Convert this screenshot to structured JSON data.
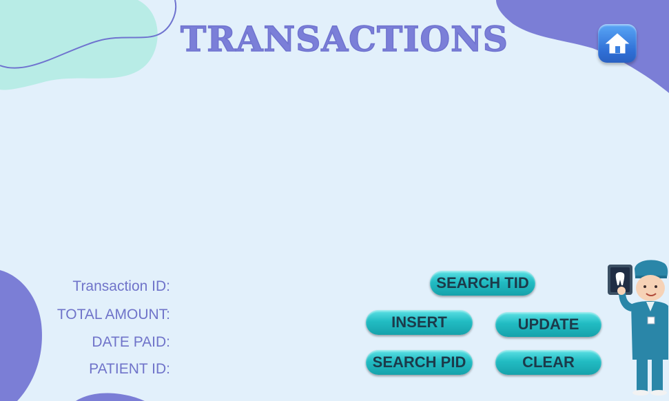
{
  "header": {
    "title": "TRANSACTIONS",
    "home_icon": "home-icon"
  },
  "form": {
    "labels": {
      "transaction_id": "Transaction ID:",
      "total_amount": "TOTAL AMOUNT:",
      "date_paid": "DATE PAID:",
      "patient_id": "PATIENT ID:"
    }
  },
  "buttons": {
    "search_tid": "SEARCH TID",
    "insert": "INSERT",
    "update": "UPDATE",
    "search_pid": "SEARCH PID",
    "clear": "CLEAR"
  },
  "colors": {
    "background": "#e2f0fb",
    "blob_purple": "#7b7ed6",
    "blob_mint": "#b8ece6",
    "button_teal": "#22bcc3",
    "label_text": "#6f73c9"
  },
  "illustration": "dentist-with-xray-illustration"
}
